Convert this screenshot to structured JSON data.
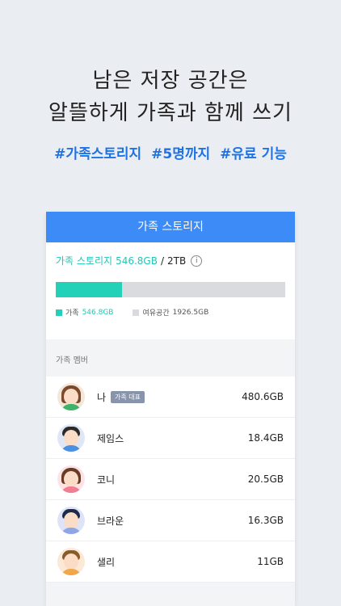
{
  "headline": {
    "line1": "남은 저장 공간은",
    "line2": "알뜰하게 가족과 함께 쓰기"
  },
  "tags": [
    "#가족스토리지",
    "#5명까지",
    "#유료 기능"
  ],
  "card": {
    "title": "가족 스토리지",
    "usage": {
      "label": "가족 스토리지",
      "used": "546.8GB",
      "separator": "/",
      "total": "2TB",
      "used_fraction": 0.29
    },
    "legend": [
      {
        "label": "가족",
        "value": "546.8GB",
        "color": "#23d1b8"
      },
      {
        "label": "여유공간",
        "value": "1926.5GB",
        "color": "#d9dbde"
      }
    ],
    "members_label": "가족 멤버",
    "members": [
      {
        "name": "나",
        "badge": "가족 대표",
        "size": "480.6GB",
        "icon": "avatar-woman-brown-hair"
      },
      {
        "name": "제임스",
        "size": "18.4GB",
        "icon": "avatar-man-glasses"
      },
      {
        "name": "코니",
        "size": "20.5GB",
        "icon": "avatar-woman-pink"
      },
      {
        "name": "브라운",
        "size": "16.3GB",
        "icon": "avatar-man-blue"
      },
      {
        "name": "샐리",
        "size": "11GB",
        "icon": "avatar-man-orange"
      }
    ]
  },
  "colors": {
    "accent_blue": "#3d8bf6",
    "tag_blue": "#1d72e8",
    "teal": "#23d1b8"
  }
}
